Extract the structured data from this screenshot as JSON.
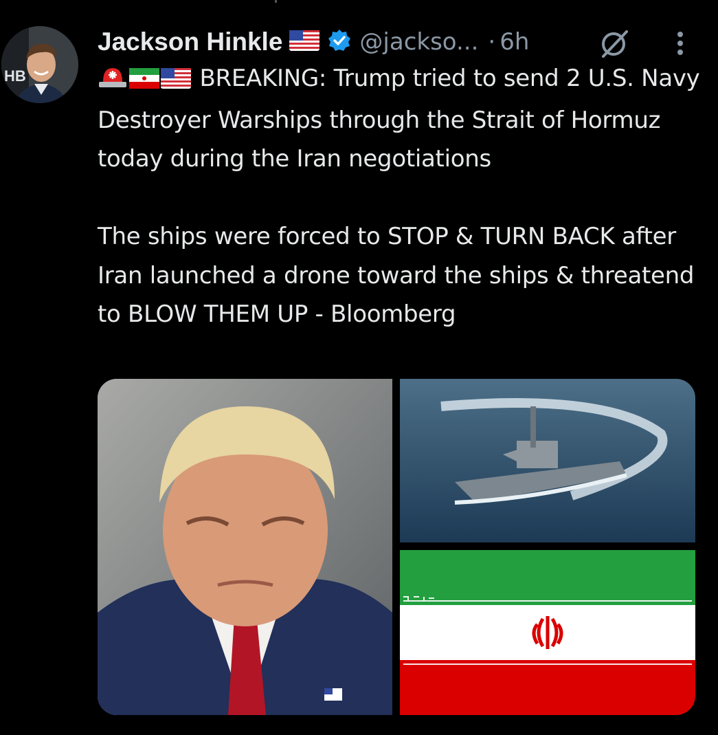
{
  "author": {
    "name": "Jackson Hinkle",
    "handle": "@jackso...",
    "separator": "·",
    "time": "6h",
    "avatar_badge": "HB",
    "icons": [
      "us-flag-icon",
      "verified-badge-icon"
    ]
  },
  "tweet": {
    "lead_icons": [
      "police-light-icon",
      "iran-flag-icon",
      "us-flag-icon"
    ],
    "paragraph1": "BREAKING: Trump tried to send 2 U.S. Navy Destroyer Warships through the Strait of Hormuz today during the Iran negotiations",
    "paragraph2": "The ships were forced to STOP & TURN BACK after Iran launched a drone toward the ships & threatend to BLOW THEM UP - Bloomberg"
  },
  "media": {
    "images": [
      "trump-portrait-photo",
      "navy-destroyer-photo",
      "iran-flag-image"
    ]
  },
  "colors": {
    "background": "#000000",
    "text": "#e7e9ea",
    "secondary": "#8b98a5",
    "verified": "#1d9bf0",
    "iran_green": "#239f40",
    "iran_red": "#da0000"
  }
}
